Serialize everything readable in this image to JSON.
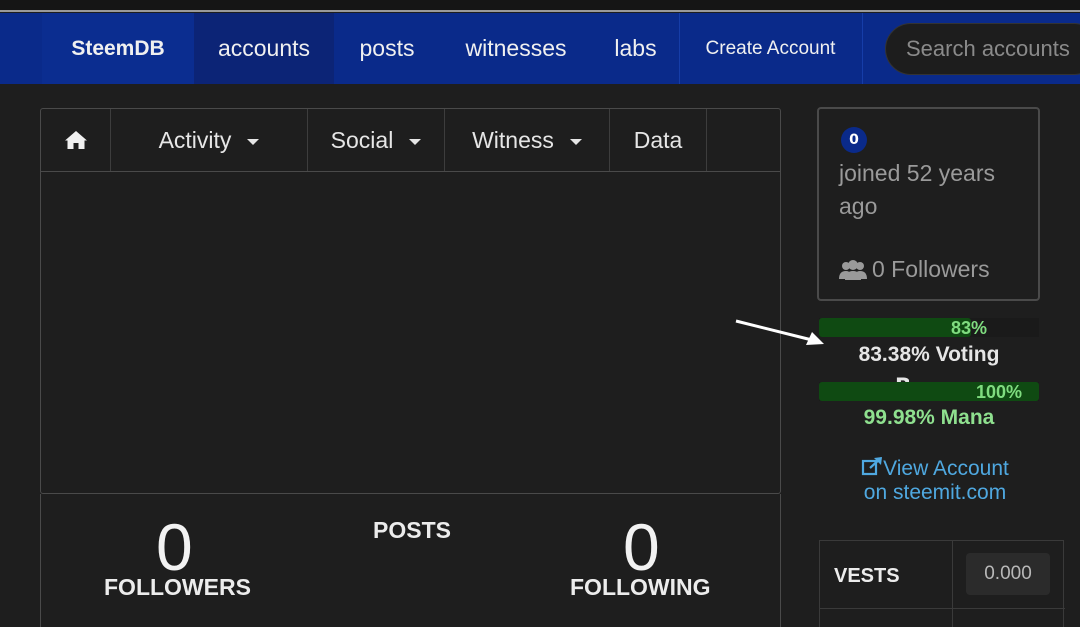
{
  "nav": {
    "brand": "SteemDB",
    "items": [
      "accounts",
      "posts",
      "witnesses",
      "labs"
    ],
    "create_account": "Create Account",
    "search_placeholder": "Search accounts"
  },
  "tabs": {
    "home_icon": "home-icon",
    "items": [
      "Activity",
      "Social",
      "Witness",
      "Data"
    ]
  },
  "stats": {
    "followers_value": "0",
    "followers_label": "FOLLOWERS",
    "posts_label": "POSTS",
    "following_value": "0",
    "following_label": "FOLLOWING"
  },
  "profile": {
    "badge": "0",
    "joined": "joined 52 years ago",
    "followers": "0 Followers"
  },
  "voting_power": {
    "percent_short": "83%",
    "fill_fraction": 0.83,
    "label": "83.38% Voting Power"
  },
  "mana": {
    "percent_short": "100%",
    "fill_fraction": 1.0,
    "label": "99.98% Mana"
  },
  "view_account": {
    "line1": "View Account",
    "line2": "on steemit.com"
  },
  "vests": {
    "key": "VESTS",
    "value": "0.000"
  },
  "colors": {
    "navbar": "#0a2a8a",
    "background": "#1e1e1e",
    "bar_fill": "#0f4a12",
    "bar_text": "#7fdc7f",
    "link": "#4fa8e0"
  }
}
